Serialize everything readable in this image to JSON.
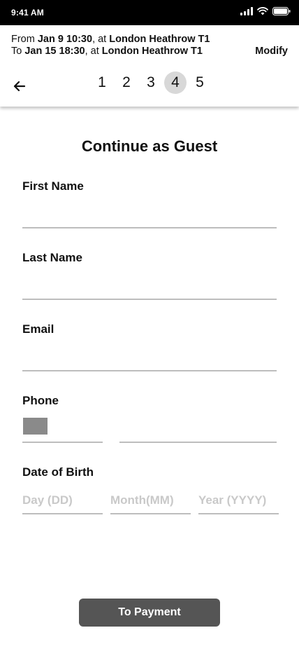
{
  "status_bar": {
    "time": "9:41 AM"
  },
  "trip": {
    "from_prefix": "From ",
    "from_date": "Jan 9 10:30",
    "from_sep": ", at ",
    "from_location": "London Heathrow T1",
    "to_prefix": "To ",
    "to_date": "Jan 15 18:30",
    "to_sep": ", at ",
    "to_location": "London Heathrow T1",
    "modify_label": "Modify"
  },
  "steps": {
    "items": [
      "1",
      "2",
      "3",
      "4",
      "5"
    ],
    "active": "4"
  },
  "form": {
    "title": "Continue as Guest",
    "first_name": {
      "label": "First Name",
      "value": ""
    },
    "last_name": {
      "label": "Last Name",
      "value": ""
    },
    "email": {
      "label": "Email",
      "value": ""
    },
    "phone": {
      "label": "Phone",
      "value": ""
    },
    "dob": {
      "label": "Date of Birth",
      "day_placeholder": "Day (DD)",
      "month_placeholder": "Month(MM)",
      "year_placeholder": "Year (YYYY)"
    },
    "submit_label": "To Payment"
  },
  "colors": {
    "primary_button": "#555555",
    "active_step": "#d8d8d8",
    "flag_placeholder": "#8a8a8a"
  },
  "icons": {
    "back": "arrow-left-icon",
    "signal": "signal-icon",
    "wifi": "wifi-icon",
    "battery": "battery-icon"
  }
}
